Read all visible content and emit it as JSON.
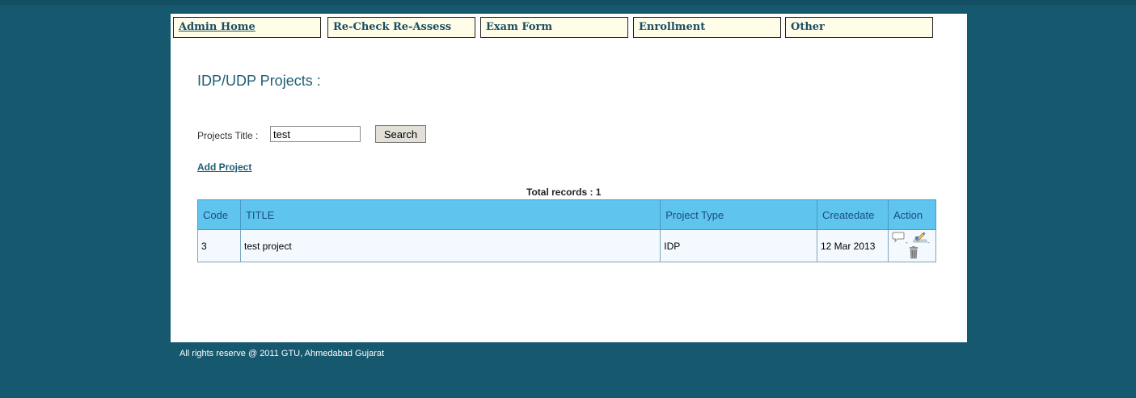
{
  "nav": {
    "items": [
      {
        "label": "Admin Home"
      },
      {
        "label": "Re-Check Re-Assess"
      },
      {
        "label": "Exam Form"
      },
      {
        "label": "Enrollment"
      },
      {
        "label": "Other"
      }
    ]
  },
  "page": {
    "title": "IDP/UDP Projects :"
  },
  "search": {
    "label": "Projects Title :",
    "value": "test",
    "button_label": "Search"
  },
  "actions": {
    "add_project": "Add Project"
  },
  "total_records": "Total records : 1",
  "table": {
    "headers": {
      "code": "Code",
      "title": "TITLE",
      "project_type": "Project Type",
      "createdate": "Createdate",
      "action": "Action"
    },
    "rows": [
      {
        "code": "3",
        "title": "test project",
        "project_type": "IDP",
        "createdate": "12 Mar 2013",
        "action_icons": [
          "comment-icon",
          "edit-pencil-icon",
          "trash-icon"
        ]
      }
    ]
  },
  "footer": {
    "text": "All rights reserve @ 2011 GTU, Ahmedabad Gujarat"
  },
  "colors": {
    "background": "#16586e",
    "header_bg": "#5fc4ee",
    "nav_bg": "#fffde8",
    "link": "#1e5d75"
  }
}
